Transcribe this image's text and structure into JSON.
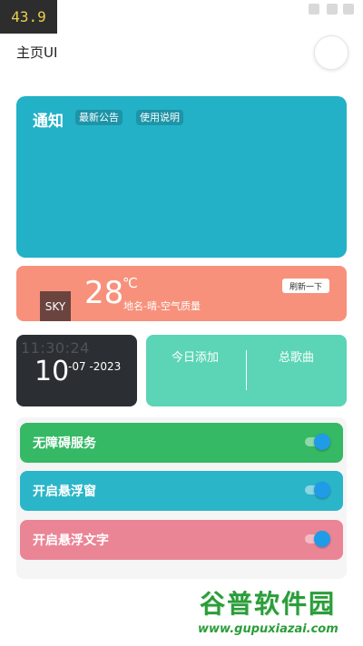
{
  "overlay": {
    "fps": "43.9"
  },
  "header": {
    "title": "主页UI"
  },
  "notice": {
    "title": "通知",
    "tags": [
      "最新公告",
      "使用说明"
    ]
  },
  "weather": {
    "icon_text": "SKY",
    "temperature": "28",
    "unit": "℃",
    "description": "地名-晴-空气质量",
    "refresh_label": "刷新一下"
  },
  "clock": {
    "time": "11:30:24",
    "day": "10",
    "month_year": "-07 -2023"
  },
  "stats": {
    "today_label": "今日添加",
    "total_label": "总歌曲"
  },
  "settings": {
    "items": [
      {
        "label": "无障碍服务",
        "color": "#35b964",
        "enabled": true
      },
      {
        "label": "开启悬浮窗",
        "color": "#2bb5c8",
        "enabled": true
      },
      {
        "label": "开启悬浮文字",
        "color": "#ea8596",
        "enabled": true
      }
    ]
  },
  "watermark": {
    "brand": "谷普软件园",
    "url": "www.gupuxiazai.com"
  },
  "colors": {
    "notice": "#23b1c7",
    "weather": "#f7917b",
    "clock": "#2b2f33",
    "stats": "#5bd5b5",
    "toggle_knob": "#1f9be8"
  }
}
